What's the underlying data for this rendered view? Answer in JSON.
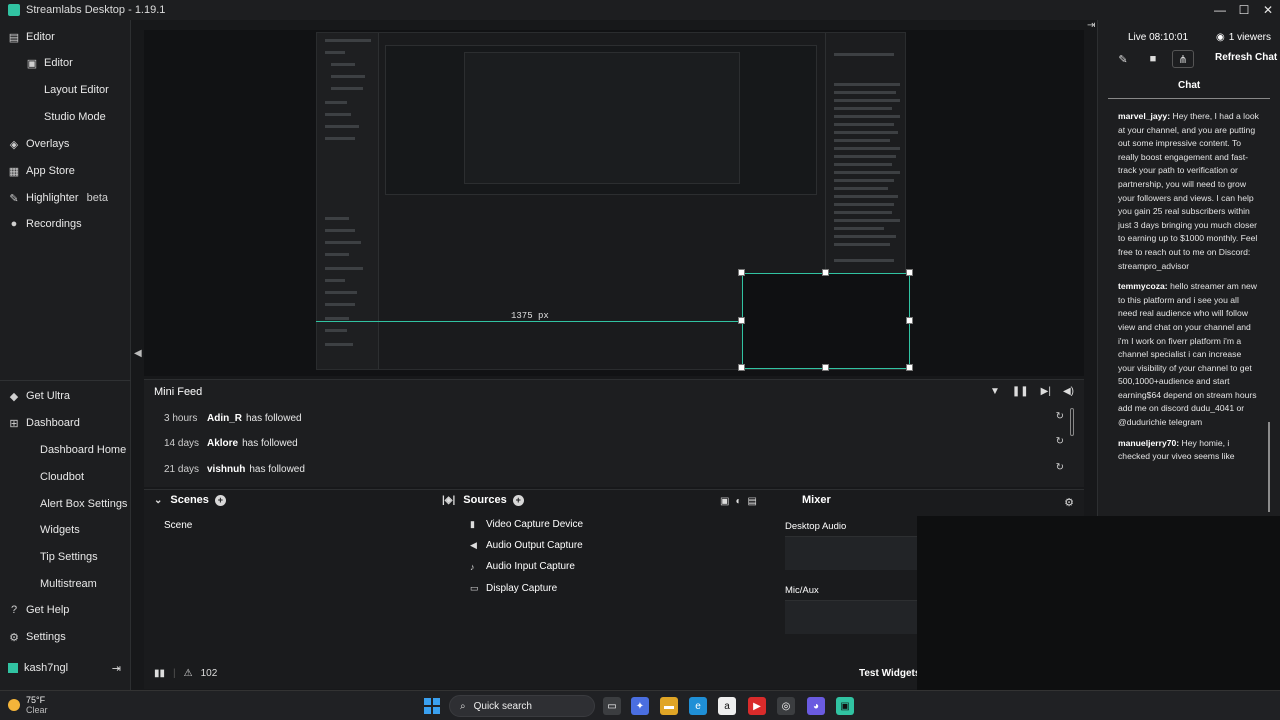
{
  "app": {
    "title": "Streamlabs Desktop - 1.19.1",
    "controls": {
      "minimize": "—",
      "maximize": "☐",
      "close": "✕"
    }
  },
  "nav": {
    "editor_section": "Editor",
    "items": [
      {
        "label": "Editor",
        "icon": "editor-icon"
      },
      {
        "label": "Layout Editor",
        "icon": "layout-icon"
      },
      {
        "label": "Studio Mode",
        "icon": "studio-icon"
      },
      {
        "label": "Overlays",
        "icon": "overlays-icon"
      },
      {
        "label": "App Store",
        "icon": "app-store-icon"
      },
      {
        "label": "Highlighter",
        "icon": "highlighter-icon",
        "badge": "beta"
      },
      {
        "label": "Recordings",
        "icon": "recordings-icon"
      }
    ],
    "bottom_items": [
      {
        "label": "Get Ultra",
        "icon": "ultra-icon"
      },
      {
        "label": "Dashboard",
        "icon": "dashboard-icon"
      },
      {
        "label": "Dashboard Home"
      },
      {
        "label": "Cloudbot"
      },
      {
        "label": "Alert Box Settings"
      },
      {
        "label": "Widgets"
      },
      {
        "label": "Tip Settings"
      },
      {
        "label": "Multistream"
      },
      {
        "label": "Get Help",
        "icon": "help-icon"
      },
      {
        "label": "Settings",
        "icon": "gear-icon"
      }
    ],
    "user": "kash7ngl"
  },
  "preview": {
    "px_label": "1375 px"
  },
  "right_panel": {
    "live_label": "Live 08:10:01",
    "viewers": "1 viewers",
    "refresh_chat": "Refresh Chat",
    "chat_tab": "Chat",
    "messages": [
      {
        "user": "marvel_jayy:",
        "text": "Hey there, I had a look at your channel, and you are putting out some impressive content. To really boost engagement and fast-track your path to verification or partnership, you will need to grow your followers and views. I can help you gain 25 real subscribers within just 3 days bringing you much closer to earning up to $1000 monthly. Feel free to reach out to me on Discord: streampro_advisor"
      },
      {
        "user": "temmycoza:",
        "text": "hello streamer am new to this platform and i see you all need real audience who will follow view and chat on your channel and i'm I work on fiverr platform i'm a channel specialist i can increase your visibility of your channel to get 500,1000+audience and start earning$64 depend on stream hours add me on discord dudu_4041 or @dudurichie telegram"
      },
      {
        "user": "manueljerry70:",
        "text": "Hey homie, i checked your viveo seems like"
      }
    ]
  },
  "mini_feed": {
    "title": "Mini Feed",
    "events": [
      {
        "time": "3 hours",
        "user": "Adin_R",
        "action": "has followed"
      },
      {
        "time": "14 days",
        "user": "Aklore",
        "action": "has followed"
      },
      {
        "time": "21 days",
        "user": "vishnuh",
        "action": "has followed"
      }
    ]
  },
  "scenes": {
    "title": "Scenes",
    "items": [
      "Scene"
    ]
  },
  "sources": {
    "title": "Sources",
    "items": [
      {
        "label": "Video Capture Device",
        "icon": "camera-icon"
      },
      {
        "label": "Audio Output Capture",
        "icon": "speaker-icon"
      },
      {
        "label": "Audio Input Capture",
        "icon": "mic-icon"
      },
      {
        "label": "Display Capture",
        "icon": "monitor-icon"
      }
    ]
  },
  "mixer": {
    "title": "Mixer",
    "channels": [
      "Desktop Audio",
      "Mic/Aux"
    ]
  },
  "status_bar": {
    "dropped": "102",
    "test_widgets": "Test Widgets"
  },
  "taskbar": {
    "temp": "75°F",
    "condition": "Clear",
    "search": "Quick search"
  },
  "colors": {
    "accent": "#31c3a2",
    "background": "#17181a",
    "panel": "#1d1e20"
  }
}
